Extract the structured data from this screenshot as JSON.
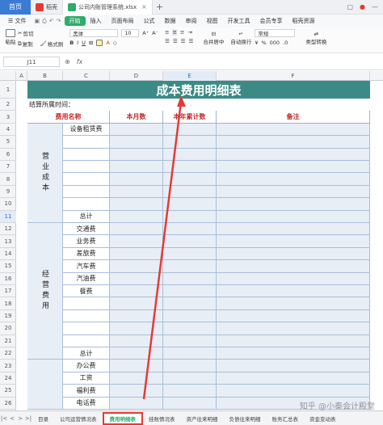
{
  "titlebar": {
    "home": "首页",
    "tabs": [
      {
        "label": "稻壳",
        "logo_color": "#e53935"
      },
      {
        "label": "公司内账管理系统.xlsx",
        "logo_color": "#2eac6b"
      }
    ],
    "close_glyph": "×",
    "plus_glyph": "+"
  },
  "menu": {
    "file": "文件",
    "items": [
      "开始",
      "插入",
      "页面布局",
      "公式",
      "数据",
      "审阅",
      "视图",
      "开发工具",
      "会员专享",
      "稻壳资源"
    ],
    "active": "开始"
  },
  "ribbon": {
    "paste": "粘贴",
    "cut": "剪切",
    "copy": "复制",
    "format_painter": "格式刷",
    "font": "黑体",
    "font_size": "10",
    "merge": "合并居中",
    "wrap": "自动换行",
    "number_format": "常规",
    "type_convert": "类型转换"
  },
  "formula_bar": {
    "cell_ref": "J11",
    "fx": "fx"
  },
  "columns": [
    "A",
    "B",
    "C",
    "D",
    "E",
    "F"
  ],
  "active_column": "E",
  "rows": [
    "1",
    "2",
    "3",
    "4",
    "5",
    "6",
    "7",
    "8",
    "9",
    "10",
    "11",
    "12",
    "13",
    "14",
    "15",
    "16",
    "17",
    "18",
    "19",
    "20",
    "21",
    "22",
    "23",
    "24",
    "25",
    "26"
  ],
  "active_row": "11",
  "sheet": {
    "title": "成本费用明细表",
    "settle_label": "结算所属时间：",
    "headers": {
      "name": "费用名称",
      "month": "本月数",
      "year": "本年累计数",
      "remark": "备注"
    },
    "categories": [
      {
        "label": "营业成本",
        "items": [
          "设备租赁费",
          "",
          "",
          "",
          "",
          "",
          "",
          "总计"
        ]
      },
      {
        "label": "经营费用",
        "items": [
          "交通费",
          "业务费",
          "差旅费",
          "汽车费",
          "汽油费",
          "餐费",
          "",
          "",
          "",
          "",
          "总计"
        ]
      },
      {
        "label": "",
        "items": [
          "办公费",
          "工资",
          "福利费",
          "电话费"
        ]
      }
    ]
  },
  "tabs": {
    "nav": [
      "|<",
      "<",
      ">",
      ">|"
    ],
    "sheets": [
      "目录",
      "公司运营情况表",
      "费用明细表",
      "挂账情况表",
      "资产往来明细",
      "负债往来明细",
      "账务汇总表",
      "资金变动表"
    ],
    "active": "费用明细表"
  },
  "watermark": "知乎 @小秦会计殿堂",
  "colors": {
    "title_band": "#3c8a86",
    "header_text": "#c62828",
    "accent_green": "#2eac6b",
    "highlight_red": "#e53935"
  }
}
